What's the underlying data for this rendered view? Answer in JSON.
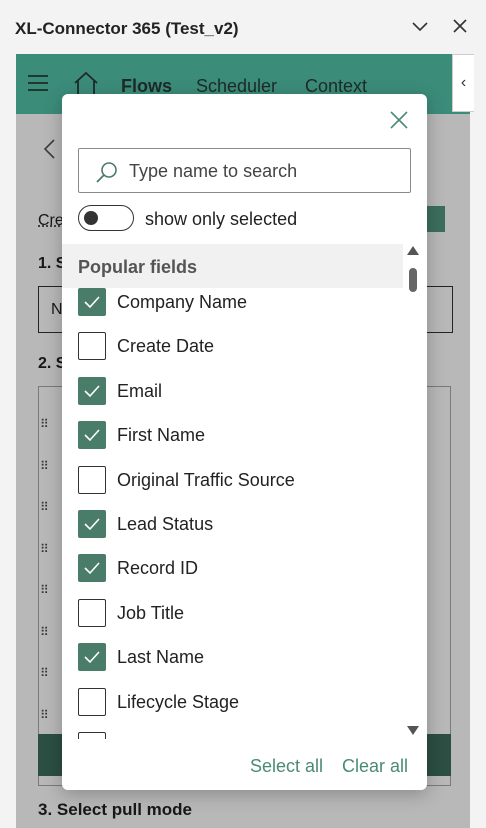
{
  "window": {
    "title": "XL-Connector 365 (Test_v2)",
    "minimize_glyph": "﹀",
    "close_glyph": "✕"
  },
  "nav": {
    "items": [
      {
        "label": "Flows"
      },
      {
        "label": "Scheduler"
      },
      {
        "label": "Context"
      }
    ],
    "collapse_glyph": "‹"
  },
  "background": {
    "cre_text": "Cre",
    "step1_prefix": "1. S",
    "input_prefix": "N",
    "step2_prefix": "2. S",
    "step3": "3. Select pull mode"
  },
  "modal": {
    "search_placeholder": "Type name to search",
    "toggle_label": "show only selected",
    "toggle_on": false,
    "section_title": "Popular fields",
    "fields": [
      {
        "label": "Company Name",
        "checked": true
      },
      {
        "label": "Create Date",
        "checked": false
      },
      {
        "label": "Email",
        "checked": true
      },
      {
        "label": "First Name",
        "checked": true
      },
      {
        "label": "Original Traffic Source",
        "checked": false
      },
      {
        "label": "Lead Status",
        "checked": true
      },
      {
        "label": "Record ID",
        "checked": true
      },
      {
        "label": "Job Title",
        "checked": false
      },
      {
        "label": "Last Name",
        "checked": true
      },
      {
        "label": "Lifecycle Stage",
        "checked": false
      }
    ],
    "select_all": "Select all",
    "clear_all": "Clear all"
  },
  "colors": {
    "accent": "#3c8c7a",
    "checkbox_checked": "#4a7c6a",
    "link": "#4a8a76"
  }
}
